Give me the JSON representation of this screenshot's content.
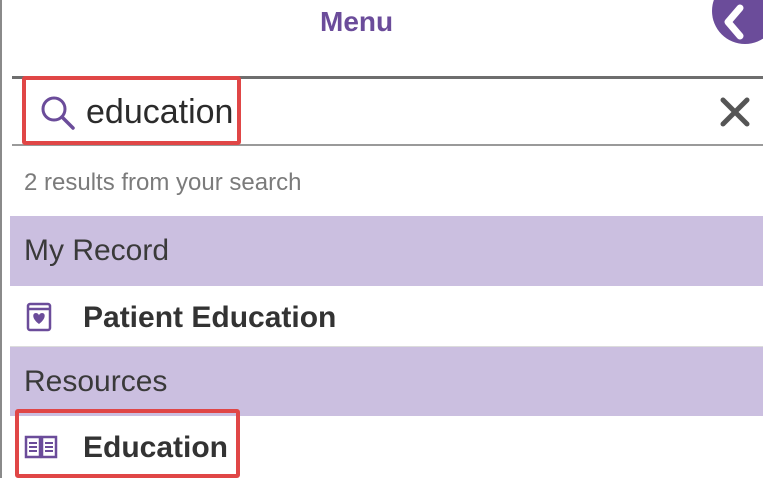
{
  "header": {
    "title": "Menu",
    "avatar_icon": "chevron-left-icon"
  },
  "search": {
    "value": "education",
    "search_icon": "search-icon",
    "clear_icon": "close-icon"
  },
  "results": {
    "count_text": "2 results from your search"
  },
  "sections": [
    {
      "title": "My Record",
      "items": [
        {
          "label": "Patient Education",
          "icon": "heart-badge-icon"
        }
      ]
    },
    {
      "title": "Resources",
      "items": [
        {
          "label": "Education",
          "icon": "open-book-icon"
        }
      ]
    }
  ],
  "colors": {
    "accent": "#6b4c9a",
    "section_bg": "#cbbfe0",
    "highlight": "#e04646"
  }
}
